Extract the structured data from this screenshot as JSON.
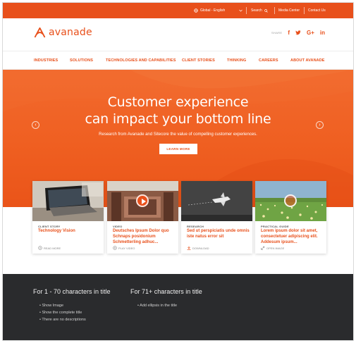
{
  "utility": {
    "region": "Global - English",
    "search": "Search",
    "media_center": "Media Center",
    "contact": "Contact Us"
  },
  "header": {
    "logo_text": "avanade",
    "share_label": "SHARE",
    "social": [
      "f",
      "t",
      "G+",
      "in"
    ]
  },
  "nav": {
    "items": [
      "INDUSTRIES",
      "SOLUTIONS",
      "TECHNOLOGIES AND CAPABILITIES",
      "CLIENT STORIES",
      "THINKING",
      "CAREERS",
      "ABOUT AVANADE"
    ]
  },
  "hero": {
    "title_line1": "Customer experience",
    "title_line2": "can impact your bottom line",
    "subtitle": "Research from Avanade and Sitecore the value of compelling customer experiences.",
    "button": "LEARN MORE"
  },
  "cards": [
    {
      "category": "CLIENT STORY",
      "title": "Technology Vision",
      "action": "READ MORE"
    },
    {
      "category": "VIDEO",
      "title": "Deutsches Ipsum Dolor quo Schnaps posidonium Schmetterling adhuc...",
      "action": "PLAY VIDEO"
    },
    {
      "category": "RESEARCH",
      "title": "Sed ut perspiciatis unde omnis iste natus error sit",
      "action": "DOWNLOAD"
    },
    {
      "category": "PRACTICAL GUIDE",
      "title": "Lorem ipsum dolor sit amet, consectetuer adipiscing elit. Addesum ipsum...",
      "action": "OPEN IMAGE"
    }
  ],
  "notes": {
    "col1_heading": "For 1 - 70 characters in title",
    "col1_items": [
      "Show Image",
      "Show the complete title",
      "There are no descriptions"
    ],
    "col2_heading": "For 71+ characters in title",
    "col2_items": [
      "Add ellipsis in the title"
    ]
  },
  "colors": {
    "brand": "#e8501b",
    "footer": "#2a2b2d"
  }
}
